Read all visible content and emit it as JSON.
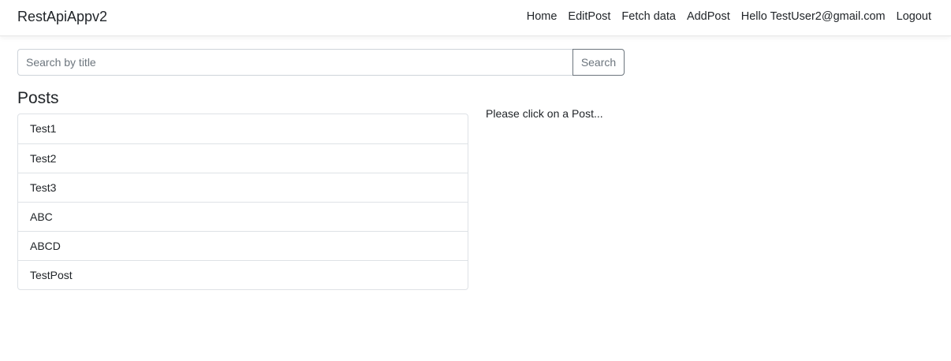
{
  "navbar": {
    "brand": "RestApiAppv2",
    "links": [
      "Home",
      "EditPost",
      "Fetch data",
      "AddPost",
      "Hello TestUser2@gmail.com",
      "Logout"
    ]
  },
  "search": {
    "placeholder": "Search by title",
    "value": "",
    "button_label": "Search"
  },
  "posts": {
    "heading": "Posts",
    "items": [
      "Test1",
      "Test2",
      "Test3",
      "ABC",
      "ABCD",
      "TestPost"
    ]
  },
  "detail": {
    "hint": "Please click on a Post..."
  }
}
